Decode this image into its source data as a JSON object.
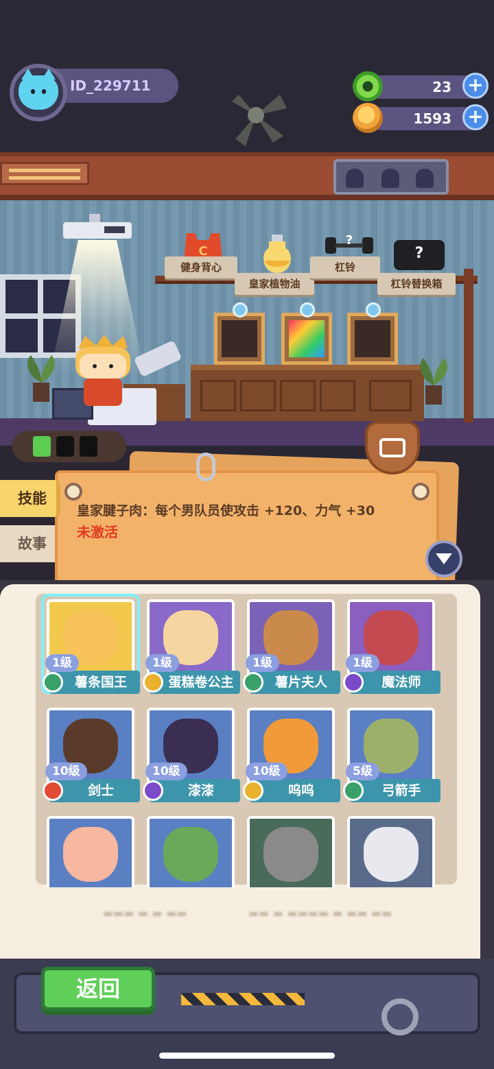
{
  "header": {
    "player_id": "ID_229711",
    "resources": [
      {
        "name": "gem",
        "icon": "green-gem-icon",
        "value": "23"
      },
      {
        "name": "coin",
        "icon": "gold-coin-icon",
        "value": "1593"
      }
    ],
    "plus_label": "+"
  },
  "room_items": [
    {
      "label": "健身背心",
      "icon": "vest-icon"
    },
    {
      "label": "皇家植物油",
      "icon": "oil-bottle-icon"
    },
    {
      "label": "杠铃",
      "icon": "barbell-icon"
    },
    {
      "label": "杠铃替换箱",
      "icon": "mystery-box-icon"
    }
  ],
  "side_tabs": {
    "skill": "技能",
    "story": "故事"
  },
  "skill_info": {
    "description": "皇家腱子肉：每个男队员使攻击 +120、力气 +30",
    "status": "未激活"
  },
  "characters": [
    {
      "level": "1级",
      "name": "薯条国王",
      "bg": "#f2c94c",
      "face": "#f7c35a",
      "badge": "#3aa06a"
    },
    {
      "level": "1级",
      "name": "蛋糕卷公主",
      "bg": "#8a6ac8",
      "face": "#f5d5a0",
      "badge": "#e8b22e"
    },
    {
      "level": "1级",
      "name": "薯片夫人",
      "bg": "#7a62b8",
      "face": "#c98a4c",
      "badge": "#3aa06a"
    },
    {
      "level": "1级",
      "name": "魔法师",
      "bg": "#8a5fc0",
      "face": "#c44a52",
      "badge": "#7a4ac8"
    },
    {
      "level": "10级",
      "name": "剑士",
      "bg": "#5a7fc2",
      "face": "#5a3a2a",
      "badge": "#e24a32"
    },
    {
      "level": "10级",
      "name": "漆漆",
      "bg": "#5a7fc2",
      "face": "#3a2e52",
      "badge": "#7a4ac8"
    },
    {
      "level": "10级",
      "name": "呜呜",
      "bg": "#5a7fc2",
      "face": "#f09a3a",
      "badge": "#e8b22e"
    },
    {
      "level": "5级",
      "name": "弓箭手",
      "bg": "#5a7fc2",
      "face": "#9db06a",
      "badge": "#3aa06a"
    },
    {
      "level": "",
      "name": "",
      "bg": "#5a7fc2",
      "face": "#f7b7a0",
      "badge": ""
    },
    {
      "level": "",
      "name": "",
      "bg": "#5a7fc2",
      "face": "#6aa85a",
      "badge": ""
    },
    {
      "level": "",
      "name": "",
      "bg": "#4a6a5a",
      "face": "#8a8a8a",
      "badge": ""
    },
    {
      "level": "",
      "name": "",
      "bg": "#5a6a8a",
      "face": "#e8e8ee",
      "badge": ""
    }
  ],
  "footer": {
    "back_label": "返回"
  }
}
